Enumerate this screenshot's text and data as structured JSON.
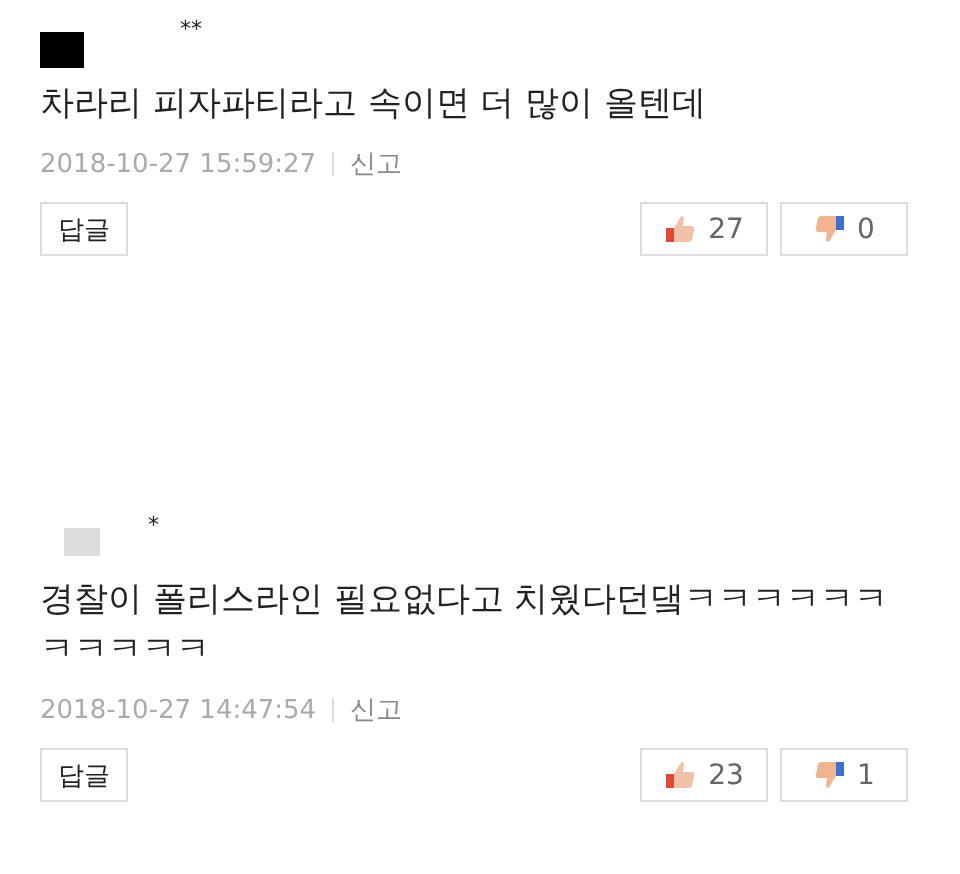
{
  "comments": [
    {
      "author": "**",
      "color": "#000000",
      "body": "차라리 피자파티라고 속이면 더 많이 올텐데",
      "date": "2018-10-27 15:59:27",
      "report": "신고",
      "reply": "답글",
      "likes": "27",
      "dislikes": "0"
    },
    {
      "author": "*",
      "color": "#dddddd",
      "body": "경찰이 폴리스라인 필요없다고 치웠다던댘ㅋㅋㅋㅋㅋㅋㅋㅋㅋㅋㅋ",
      "date": "2018-10-27 14:47:54",
      "report": "신고",
      "reply": "답글",
      "likes": "23",
      "dislikes": "1"
    }
  ]
}
